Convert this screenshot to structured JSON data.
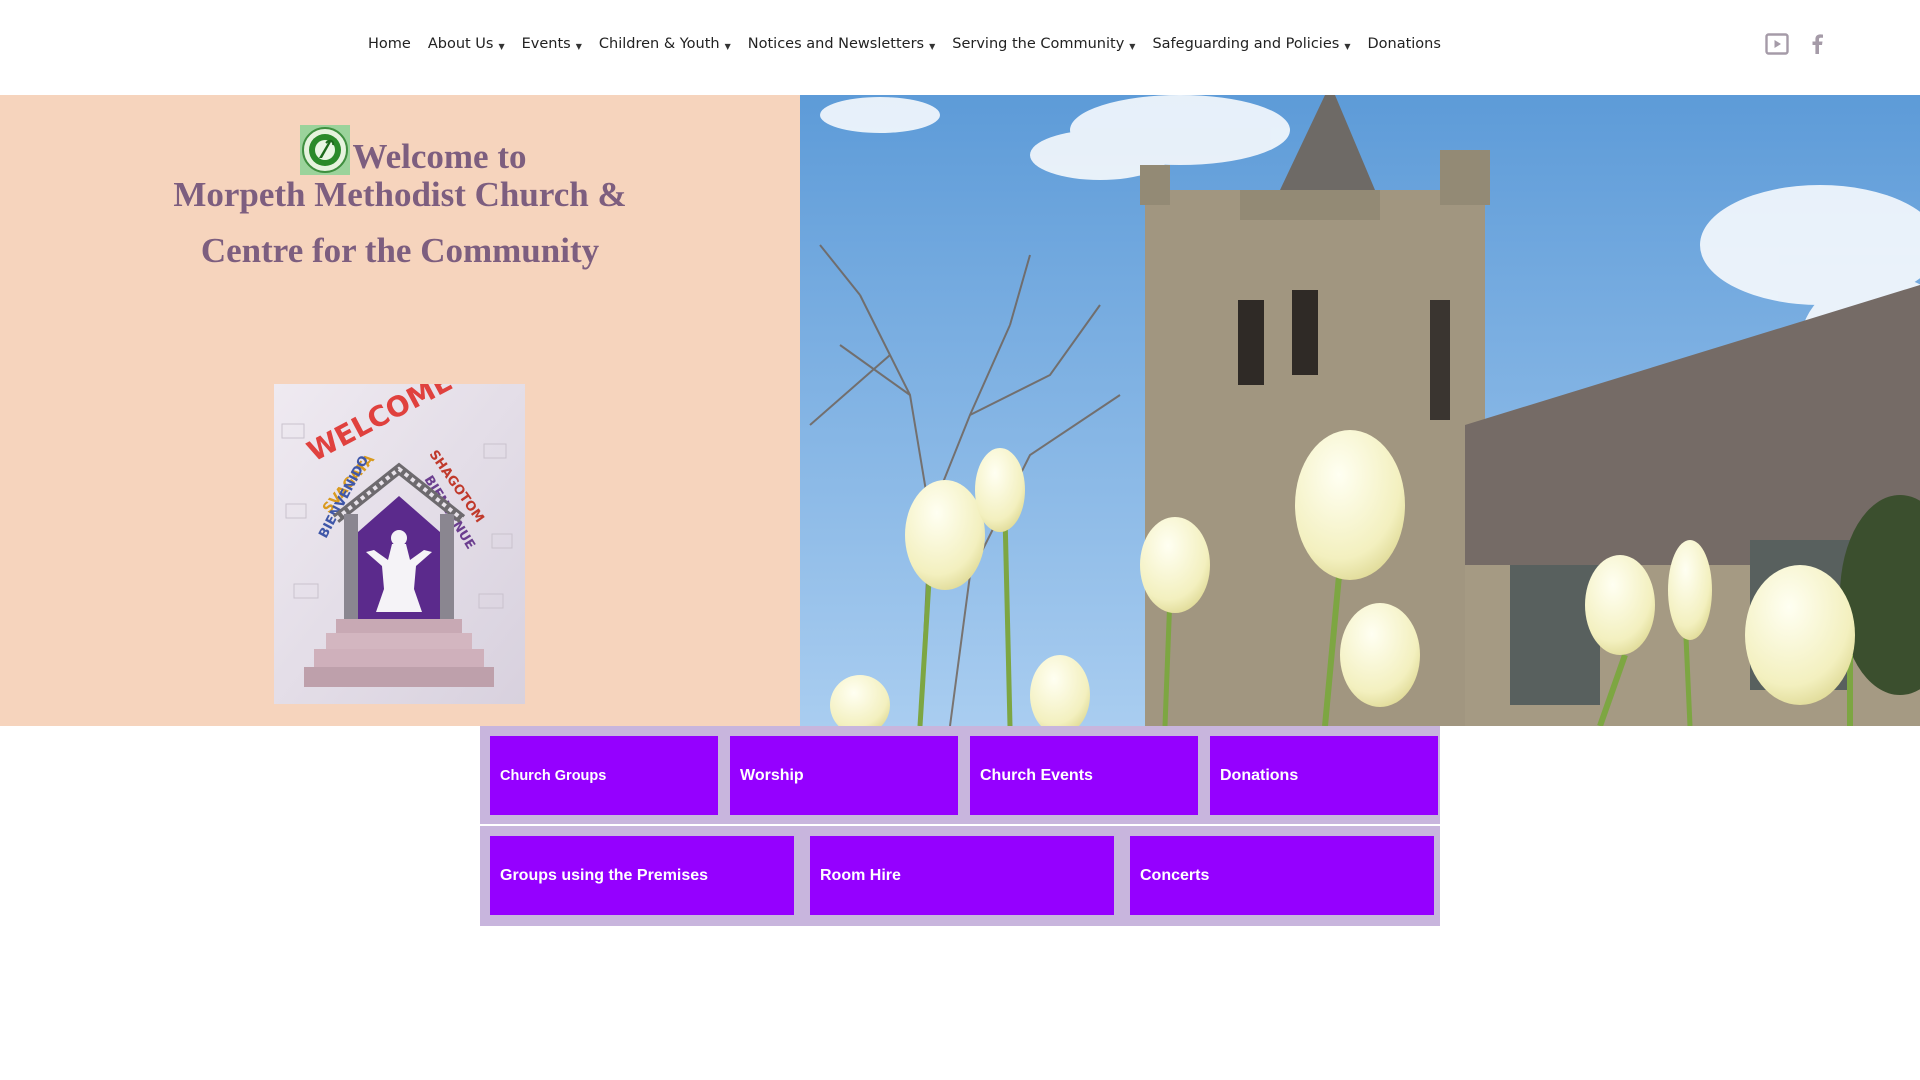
{
  "nav": {
    "items": [
      {
        "label": "Home",
        "has_dropdown": false
      },
      {
        "label": "About Us",
        "has_dropdown": true
      },
      {
        "label": "Events",
        "has_dropdown": true
      },
      {
        "label": "Children & Youth",
        "has_dropdown": true
      },
      {
        "label": "Notices and Newsletters",
        "has_dropdown": true
      },
      {
        "label": "Serving the Community",
        "has_dropdown": true
      },
      {
        "label": "Safeguarding and Policies",
        "has_dropdown": true
      },
      {
        "label": "Donations",
        "has_dropdown": false
      }
    ],
    "caret": "▼",
    "social": [
      {
        "name": "youtube-icon"
      },
      {
        "name": "facebook-icon"
      }
    ]
  },
  "hero": {
    "welcome_line1": "Welcome to",
    "welcome_line2": "Morpeth Methodist Church &",
    "welcome_line3": "Centre for the Community",
    "banner_words": [
      "WELCOME",
      "SVAGATA",
      "SHAGOTOM",
      "BIENVENIDO",
      "BIENVENUE"
    ],
    "colors": {
      "panel": "#f6d4bd",
      "heading": "#7d5e7f"
    }
  },
  "tiles": {
    "row1": [
      "Church Groups",
      "Worship",
      "Church Events",
      "Donations"
    ],
    "row2": [
      "Groups using the Premises",
      "Room Hire",
      "Concerts"
    ],
    "colors": {
      "tile": "#9500ff",
      "frame": "#c8b5dd"
    }
  }
}
